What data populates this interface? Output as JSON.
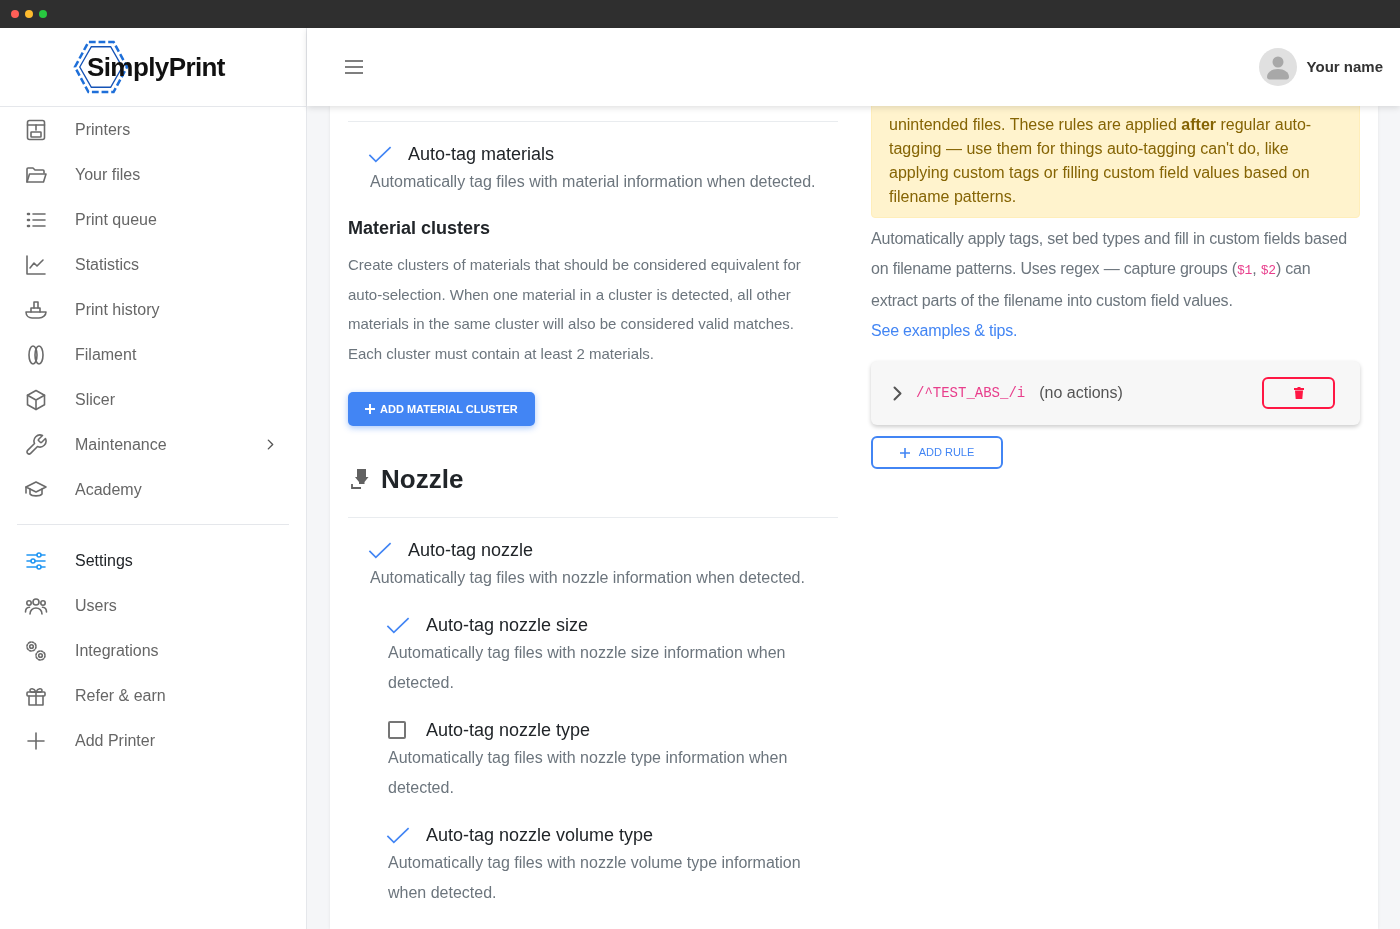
{
  "sidebar": {
    "logo": "SimplyPrint",
    "groups": [
      {
        "items": [
          {
            "label": "Printers",
            "selected": false,
            "expandable": false
          },
          {
            "label": "Your files",
            "selected": false,
            "expandable": false
          },
          {
            "label": "Print queue",
            "selected": false,
            "expandable": false
          },
          {
            "label": "Statistics",
            "selected": false,
            "expandable": false
          },
          {
            "label": "Print history",
            "selected": false,
            "expandable": false
          },
          {
            "label": "Filament",
            "selected": false,
            "expandable": false
          },
          {
            "label": "Slicer",
            "selected": false,
            "expandable": false
          },
          {
            "label": "Maintenance",
            "selected": false,
            "expandable": true
          },
          {
            "label": "Academy",
            "selected": false,
            "expandable": false
          }
        ]
      },
      {
        "items": [
          {
            "label": "Settings",
            "selected": true,
            "expandable": false
          },
          {
            "label": "Users",
            "selected": false,
            "expandable": false
          },
          {
            "label": "Integrations",
            "selected": false,
            "expandable": false
          },
          {
            "label": "Refer & earn",
            "selected": false,
            "expandable": false
          },
          {
            "label": "Add Printer",
            "selected": false,
            "expandable": false
          }
        ]
      }
    ]
  },
  "header": {
    "user_name": "Your name"
  },
  "materials": {
    "options": [
      {
        "label": "Auto-tag materials",
        "description": "Automatically tag files with material information when detected.",
        "checked": true
      }
    ],
    "clusters": {
      "title": "Material clusters",
      "description": "Create clusters of materials that should be considered equivalent for auto-selection. When one material in a cluster is detected, all other materials in the same cluster will also be considered valid matches. Each cluster must contain at least 2 materials.",
      "button": "ADD MATERIAL CLUSTER"
    }
  },
  "nozzle": {
    "title": "Nozzle",
    "options": [
      {
        "label": "Auto-tag nozzle",
        "description": "Automatically tag files with nozzle information when detected.",
        "checked": true,
        "children": [
          {
            "label": "Auto-tag nozzle size",
            "description": "Automatically tag files with nozzle size information when detected.",
            "checked": true
          },
          {
            "label": "Auto-tag nozzle type",
            "description": "Automatically tag files with nozzle type information when detected.",
            "checked": false
          },
          {
            "label": "Auto-tag nozzle volume type",
            "description": "Automatically tag files with nozzle volume type information when detected.",
            "checked": true
          }
        ]
      }
    ]
  },
  "filename_rules": {
    "notice": "unintended files. These rules are applied **after** regular auto-tagging — use them for things auto-tagging can't do, like applying custom tags or filling custom field values based on filename patterns.",
    "description": [
      {
        "kind": "text",
        "text": "Automatically apply tags, set bed types and fill in custom fields based on filename patterns. Uses regex — capture groups ("
      },
      {
        "kind": "code",
        "text": "$1"
      },
      {
        "kind": "text",
        "text": ", "
      },
      {
        "kind": "code",
        "text": "$2"
      },
      {
        "kind": "text",
        "text": ") can extract parts of the filename into custom field values. "
      },
      {
        "kind": "link",
        "text": "See examples & tips."
      }
    ],
    "rules": [
      {
        "pattern": "/^TEST_ABS_/i",
        "summary": "(no actions)",
        "expanded": false
      }
    ],
    "add_button": "ADD RULE"
  }
}
